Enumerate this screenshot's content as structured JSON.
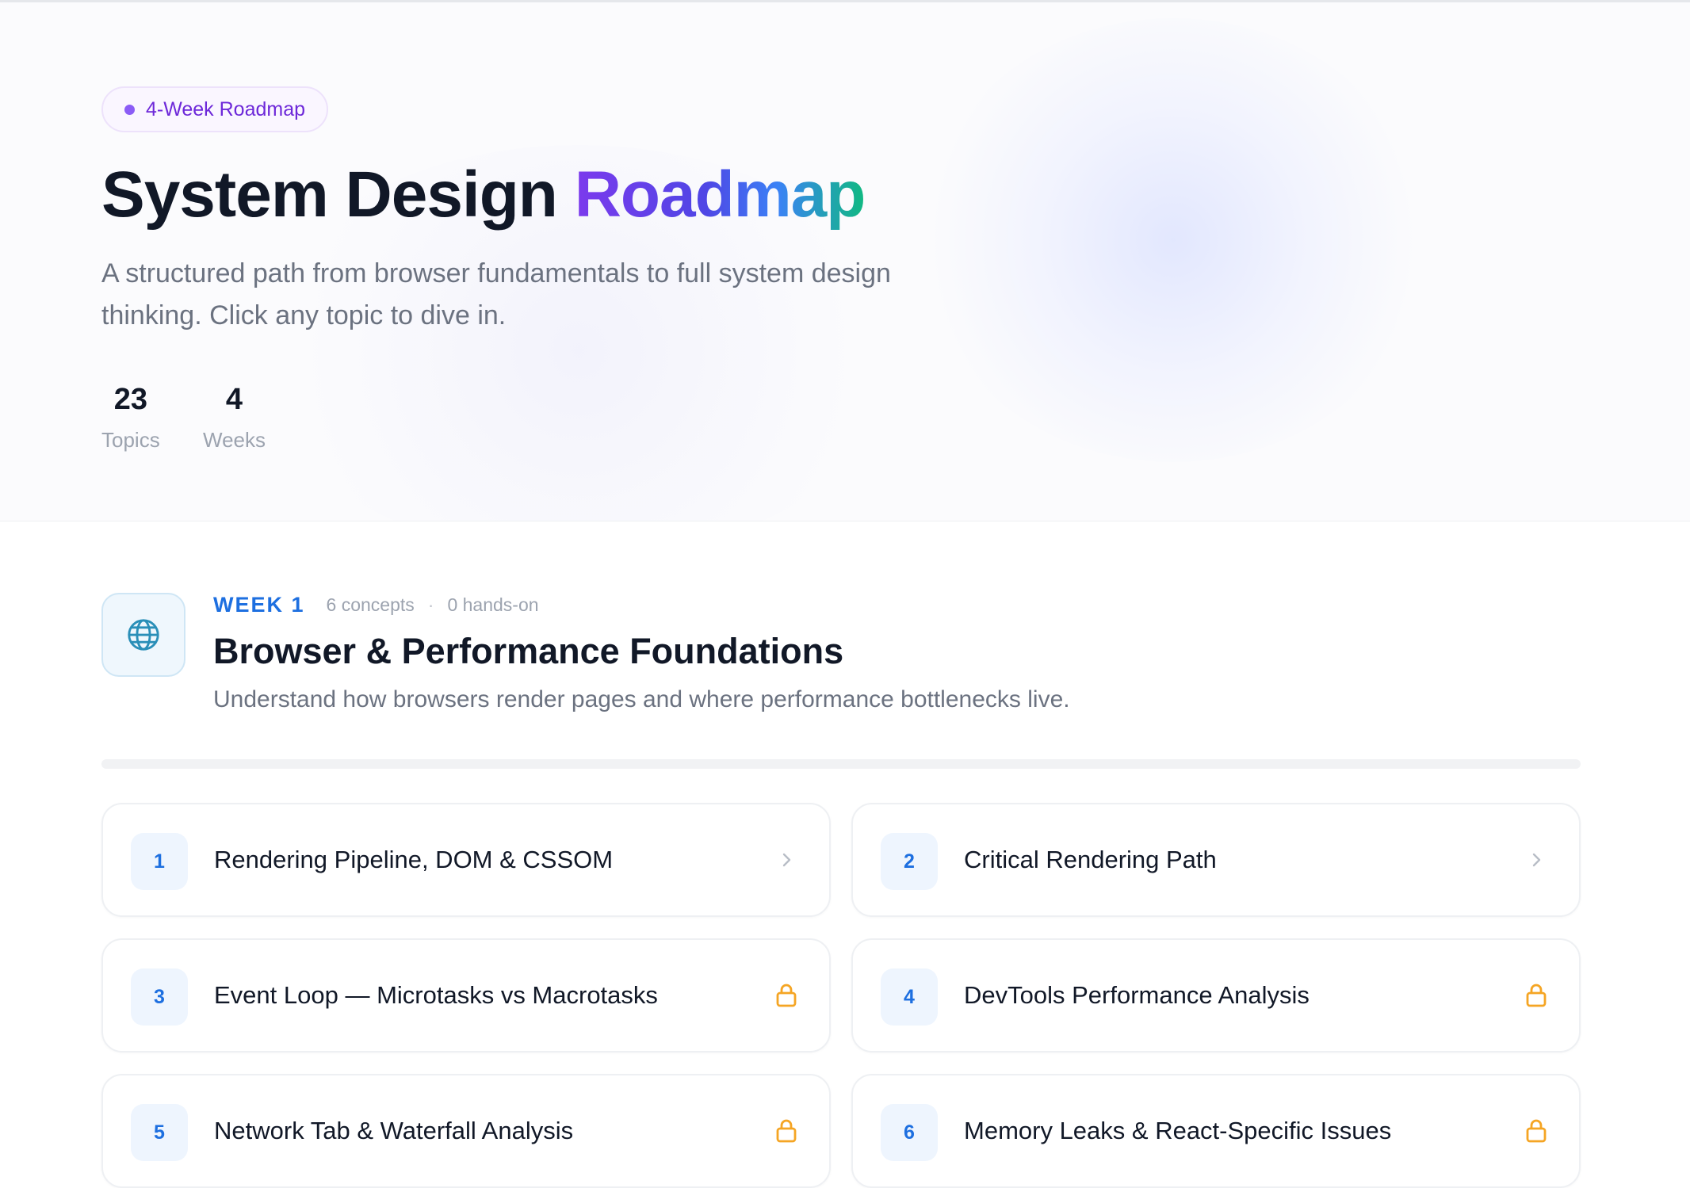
{
  "hero": {
    "badge_label": "4-Week Roadmap",
    "title_main": "System Design",
    "title_accent": "Roadmap",
    "subtitle": "A structured path from browser fundamentals to full system design thinking. Click any topic to dive in.",
    "stats": [
      {
        "value": "23",
        "label": "Topics"
      },
      {
        "value": "4",
        "label": "Weeks"
      }
    ]
  },
  "week": {
    "tag": "WEEK 1",
    "concepts": "6 concepts",
    "separator": "·",
    "hands_on": "0 hands-on",
    "icon": "globe-icon",
    "title": "Browser & Performance Foundations",
    "description": "Understand how browsers render pages and where performance bottlenecks live."
  },
  "topics": [
    {
      "number": "1",
      "title": "Rendering Pipeline, DOM & CSSOM",
      "status": "open",
      "icon": "chevron-right-icon"
    },
    {
      "number": "2",
      "title": "Critical Rendering Path",
      "status": "open",
      "icon": "chevron-right-icon"
    },
    {
      "number": "3",
      "title": "Event Loop — Microtasks vs Macrotasks",
      "status": "locked",
      "icon": "lock-icon"
    },
    {
      "number": "4",
      "title": "DevTools Performance Analysis",
      "status": "locked",
      "icon": "lock-icon"
    },
    {
      "number": "5",
      "title": "Network Tab & Waterfall Analysis",
      "status": "locked",
      "icon": "lock-icon"
    },
    {
      "number": "6",
      "title": "Memory Leaks & React-Specific Issues",
      "status": "locked",
      "icon": "lock-icon"
    }
  ],
  "colors": {
    "accent_blue": "#1d6fe0",
    "accent_purple": "#7c3aed",
    "lock_orange": "#f5a524",
    "chevron_gray": "#b8bdc6"
  }
}
